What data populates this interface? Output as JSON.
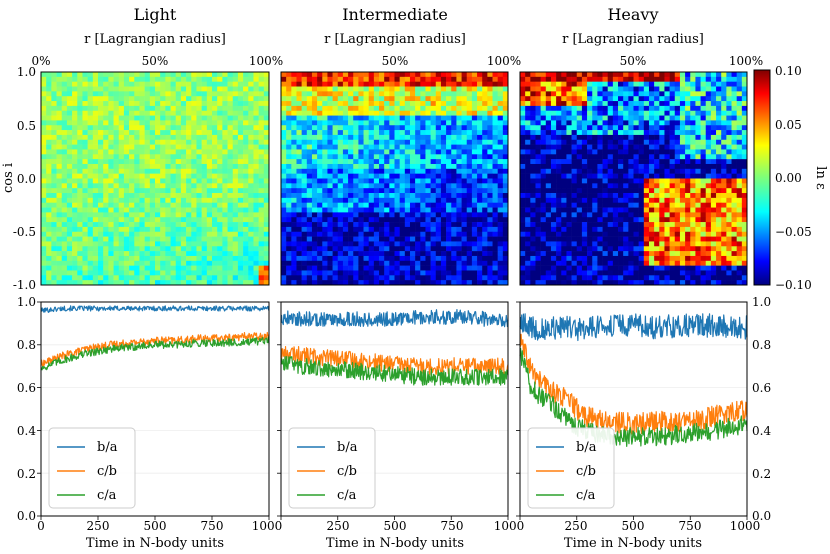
{
  "figure": {
    "columns": [
      "Light",
      "Intermediate",
      "Heavy"
    ],
    "top_axis_label": "r [Lagrangian radius]",
    "top_ticks": [
      "0%",
      "50%",
      "100%"
    ],
    "top_y_label": "cos i",
    "top_y_ticks": [
      "1.0",
      "0.5",
      "0.0",
      "-0.5",
      "-1.0"
    ],
    "colorbar_label": "ln ε",
    "colorbar_ticks": [
      "0.10",
      "0.05",
      "0.00",
      "−0.05",
      "−0.10"
    ],
    "bottom_x_label": "Time in N-body units",
    "bottom_x_ticks": [
      "0",
      "250",
      "500",
      "750",
      "1000"
    ],
    "bottom_y_ticks": [
      "1.0",
      "0.8",
      "0.6",
      "0.4",
      "0.2",
      "0.0"
    ],
    "legend": [
      "b/a",
      "c/b",
      "c/a"
    ]
  },
  "colors": {
    "b_a": "#1f77b4",
    "c_b": "#ff7f0e",
    "c_a": "#2ca02c"
  },
  "chart_data": [
    {
      "type": "heatmap",
      "title": "Light",
      "xlabel": "r [Lagrangian radius]",
      "ylabel": "cos i",
      "xlim": [
        0,
        100
      ],
      "ylim": [
        -1.0,
        1.0
      ],
      "colorbar": {
        "label": "ln ε",
        "range": [
          -0.1,
          0.1
        ],
        "colormap": "jet"
      },
      "value_summary": "mostly near 0.00 (-0.02 to 0.02), slightly negative toward cos i = -0.5 and large r"
    },
    {
      "type": "heatmap",
      "title": "Intermediate",
      "xlabel": "r [Lagrangian radius]",
      "xlim": [
        0,
        100
      ],
      "ylim": [
        -1.0,
        1.0
      ],
      "colorbar": {
        "label": "ln ε",
        "range": [
          -0.1,
          0.1
        ],
        "colormap": "jet"
      },
      "value_summary": "positive (~0.06 to 0.10) near cos i = 1, negative (~-0.08) for cos i < -0.3"
    },
    {
      "type": "heatmap",
      "title": "Heavy",
      "xlabel": "r [Lagrangian radius]",
      "xlim": [
        0,
        100
      ],
      "ylim": [
        -1.0,
        1.0
      ],
      "colorbar": {
        "label": "ln ε",
        "range": [
          -0.1,
          0.1
        ],
        "colormap": "jet"
      },
      "value_summary": "strongly positive (~0.10) near cos i = 1 and at outer radii around cos i = -0.2, strongly negative (~-0.10) elsewhere"
    },
    {
      "type": "line",
      "xlabel": "Time in N-body units",
      "xlim": [
        0,
        1000
      ],
      "ylim": [
        0.0,
        1.0
      ],
      "x": [
        0,
        100,
        200,
        300,
        400,
        500,
        600,
        700,
        800,
        900,
        1000
      ],
      "series": [
        {
          "name": "b/a",
          "values": [
            0.96,
            0.97,
            0.97,
            0.97,
            0.97,
            0.97,
            0.97,
            0.97,
            0.97,
            0.97,
            0.97
          ]
        },
        {
          "name": "c/b",
          "values": [
            0.71,
            0.75,
            0.78,
            0.8,
            0.81,
            0.82,
            0.82,
            0.83,
            0.83,
            0.84,
            0.84
          ]
        },
        {
          "name": "c/a",
          "values": [
            0.69,
            0.73,
            0.76,
            0.78,
            0.79,
            0.8,
            0.8,
            0.81,
            0.81,
            0.81,
            0.82
          ]
        }
      ]
    },
    {
      "type": "line",
      "xlabel": "Time in N-body units",
      "xlim": [
        0,
        1000
      ],
      "ylim": [
        0.0,
        1.0
      ],
      "x": [
        0,
        100,
        200,
        300,
        400,
        500,
        600,
        700,
        800,
        900,
        1000
      ],
      "series": [
        {
          "name": "b/a",
          "values": [
            0.93,
            0.92,
            0.92,
            0.92,
            0.92,
            0.92,
            0.93,
            0.93,
            0.93,
            0.92,
            0.91
          ]
        },
        {
          "name": "c/b",
          "values": [
            0.76,
            0.75,
            0.74,
            0.73,
            0.72,
            0.71,
            0.7,
            0.7,
            0.7,
            0.7,
            0.7
          ]
        },
        {
          "name": "c/a",
          "values": [
            0.72,
            0.7,
            0.69,
            0.68,
            0.67,
            0.66,
            0.65,
            0.65,
            0.65,
            0.65,
            0.65
          ]
        }
      ]
    },
    {
      "type": "line",
      "xlabel": "Time in N-body units",
      "xlim": [
        0,
        1000
      ],
      "ylim": [
        0.0,
        1.0
      ],
      "x": [
        0,
        50,
        100,
        150,
        200,
        250,
        300,
        400,
        500,
        600,
        700,
        800,
        900,
        1000
      ],
      "series": [
        {
          "name": "b/a",
          "values": [
            0.9,
            0.88,
            0.87,
            0.88,
            0.88,
            0.87,
            0.88,
            0.89,
            0.89,
            0.88,
            0.89,
            0.89,
            0.89,
            0.88
          ]
        },
        {
          "name": "c/b",
          "values": [
            0.82,
            0.68,
            0.62,
            0.58,
            0.55,
            0.5,
            0.46,
            0.44,
            0.43,
            0.44,
            0.44,
            0.45,
            0.48,
            0.5
          ]
        },
        {
          "name": "c/a",
          "values": [
            0.76,
            0.6,
            0.55,
            0.51,
            0.46,
            0.42,
            0.39,
            0.37,
            0.37,
            0.37,
            0.38,
            0.39,
            0.41,
            0.43
          ]
        }
      ]
    }
  ]
}
